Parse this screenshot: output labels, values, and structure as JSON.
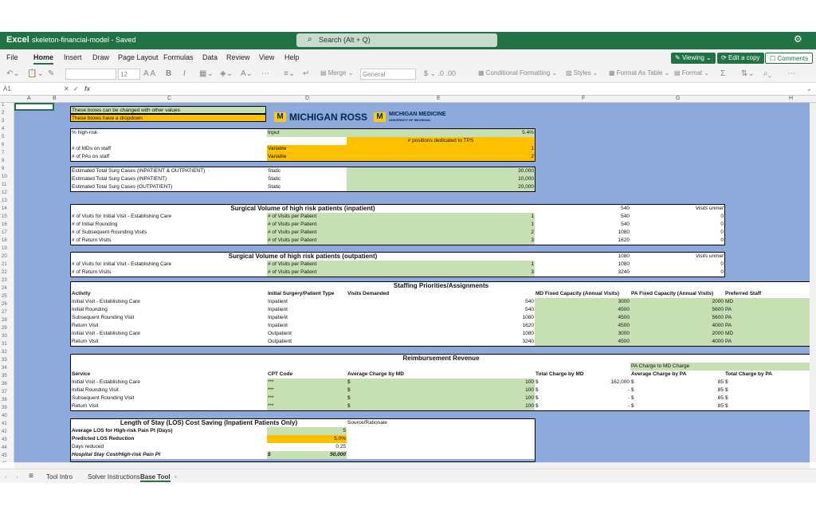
{
  "app": {
    "name": "Excel",
    "doc": "skeleton-financial-model - Saved",
    "search": "Search (Alt + Q)"
  },
  "tabs": [
    "File",
    "Home",
    "Insert",
    "Draw",
    "Page Layout",
    "Formulas",
    "Data",
    "Review",
    "View",
    "Help"
  ],
  "ribbon_buttons": {
    "viewing": "Viewing",
    "edit": "Edit a copy",
    "comments": "Comments"
  },
  "toolbar": {
    "font_size": "12",
    "number_format": "General",
    "merge": "Merge",
    "cond_format": "Conditional Formatting",
    "styles": "Styles",
    "format_table": "Format As Table",
    "format": "Format"
  },
  "formula": {
    "namebox": "A1",
    "fx": "fx"
  },
  "columns": [
    "A",
    "B",
    "C",
    "D",
    "E",
    "F",
    "G",
    "H"
  ],
  "rows": [
    "1",
    "2",
    "3",
    "4",
    "5",
    "6",
    "7",
    "8",
    "9",
    "10",
    "11",
    "12",
    "13",
    "14",
    "15",
    "16",
    "17",
    "18",
    "19",
    "20",
    "21",
    "22",
    "23",
    "24",
    "25",
    "26",
    "27",
    "28",
    "29",
    "30",
    "31",
    "32",
    "33",
    "34",
    "35",
    "36",
    "37",
    "38",
    "39",
    "40",
    "41",
    "42",
    "43",
    "44",
    "45",
    "46",
    "47"
  ],
  "legend": {
    "green": "These boxes can be changed with other values",
    "orange": "These boxes have a dropdown"
  },
  "logo": {
    "ross": "MICHIGAN ROSS",
    "med1": "MICHIGAN MEDICINE",
    "med2": "UNIVERSITY OF MICHIGAN",
    "m": "M"
  },
  "inputs": {
    "high_risk_label": "% high-risk",
    "high_risk_type": "Input",
    "high_risk_val": "5.4%",
    "tps_label": "# positions dedicated to TPS",
    "mds_label": "# of MDs on staff",
    "mds_type": "Variable",
    "mds_val": "1",
    "pas_label": "# of PAs on staff",
    "pas_type": "Variable",
    "pas_val": "2"
  },
  "cases": [
    {
      "label": "Estimated Total Surg Cases (INPATIENT & OUTPATIENT)",
      "type": "Static",
      "val": "30,000"
    },
    {
      "label": "Estimated Total Surg Cases (INPATIENT)",
      "type": "Static",
      "val": "10,000"
    },
    {
      "label": "Estimated Total Surg Cases (OUTPATIENT)",
      "type": "Static",
      "val": "20,000"
    }
  ],
  "inpatient": {
    "title": "Surgical Volume of high risk patients (inpatient)",
    "total": "540",
    "unmet": "Visits unmet",
    "rows": [
      {
        "label": "# of Visits for Initial Visit - Establishing Care",
        "unit": "# of Visits per Patient",
        "n": "1",
        "v": "540",
        "u": "0"
      },
      {
        "label": "# of Initial Rounding",
        "unit": "# of Visits per Patient",
        "n": "1",
        "v": "540",
        "u": "0"
      },
      {
        "label": "# of Subsequent Rounding Visits",
        "unit": "# of Visits per Patient",
        "n": "2",
        "v": "1080",
        "u": "0"
      },
      {
        "label": "# of Return Visits",
        "unit": "# of Visits per Patient",
        "n": "3",
        "v": "1620",
        "u": "0"
      }
    ]
  },
  "outpatient": {
    "title": "Surgical Volume of high risk patients (outpatient)",
    "total": "1080",
    "unmet": "Visits unmet",
    "rows": [
      {
        "label": "# of Visits for Initial Visit - Establishing Care",
        "unit": "# of Visits per Patient",
        "n": "1",
        "v": "1080",
        "u": "0"
      },
      {
        "label": "# of Return Visits",
        "unit": "# of Visits per Patient",
        "n": "3",
        "v": "3240",
        "u": "0"
      }
    ]
  },
  "staffing": {
    "title": "Staffing Priorities/Assignments",
    "headers": [
      "Activity",
      "Initial Surgery/Patient Type",
      "Visits Demanded",
      "MD Fixed Capacity (Annual Visits)",
      "PA Fixed Capacity (Annual Visits)",
      "Preferred Staff"
    ],
    "rows": [
      [
        "Initial Visit - Establishing Care",
        "Inpatient",
        "540",
        "3000",
        "2000",
        "MD"
      ],
      [
        "Initial Rounding",
        "Inpatient",
        "540",
        "4500",
        "5600",
        "PA"
      ],
      [
        "Subsequent Rounding Visit",
        "Inpatient",
        "1080",
        "4500",
        "5600",
        "PA"
      ],
      [
        "Return Visit",
        "Inpatient",
        "1620",
        "4500",
        "4000",
        "PA"
      ],
      [
        "Initial Visit - Establishing Care",
        "Outpatient",
        "1080",
        "3000",
        "2000",
        "MD"
      ],
      [
        "Return Visit",
        "Outpatient",
        "3240",
        "4500",
        "4000",
        "PA"
      ]
    ]
  },
  "reimb": {
    "title": "Reimbursement Revenue",
    "pa_charge": "PA Charge to MD Charge",
    "headers": [
      "Service",
      "CPT Code",
      "Average Charge by MD",
      "Total Charge by MD",
      "Average Charge by PA",
      "Total Charge by PA"
    ],
    "rows": [
      [
        "Initial Visit - Establishing Care",
        "***",
        "$",
        "100",
        "$",
        "162,000",
        "$",
        "85",
        "$"
      ],
      [
        "Initial Rounding Visit",
        "***",
        "$",
        "100",
        "$",
        "-",
        "$",
        "85",
        "$"
      ],
      [
        "Subsequent Rounding Visit",
        "***",
        "$",
        "100",
        "$",
        "-",
        "$",
        "85",
        "$"
      ],
      [
        "Return Visit",
        "***",
        "$",
        "100",
        "$",
        "-",
        "$",
        "85",
        "$"
      ]
    ]
  },
  "los": {
    "title": "Length of Stay (LOS) Cost Saving (Inpatient Patients Only)",
    "source": "Source/Rationale",
    "r1": "Average LOS for High-risk Pain Pt (Days)",
    "r1v": "5",
    "r2": "Predicted LOS Reduction",
    "r2v": "5.0%",
    "r3": "Days reduced",
    "r3v": "0.25",
    "r4": "Hospital Stay Cost/High-risk Pain Pt",
    "r4d": "$",
    "r4v": "50,000"
  },
  "sheets": [
    "Tool Intro",
    "Solver Instructions",
    "Base Tool"
  ]
}
